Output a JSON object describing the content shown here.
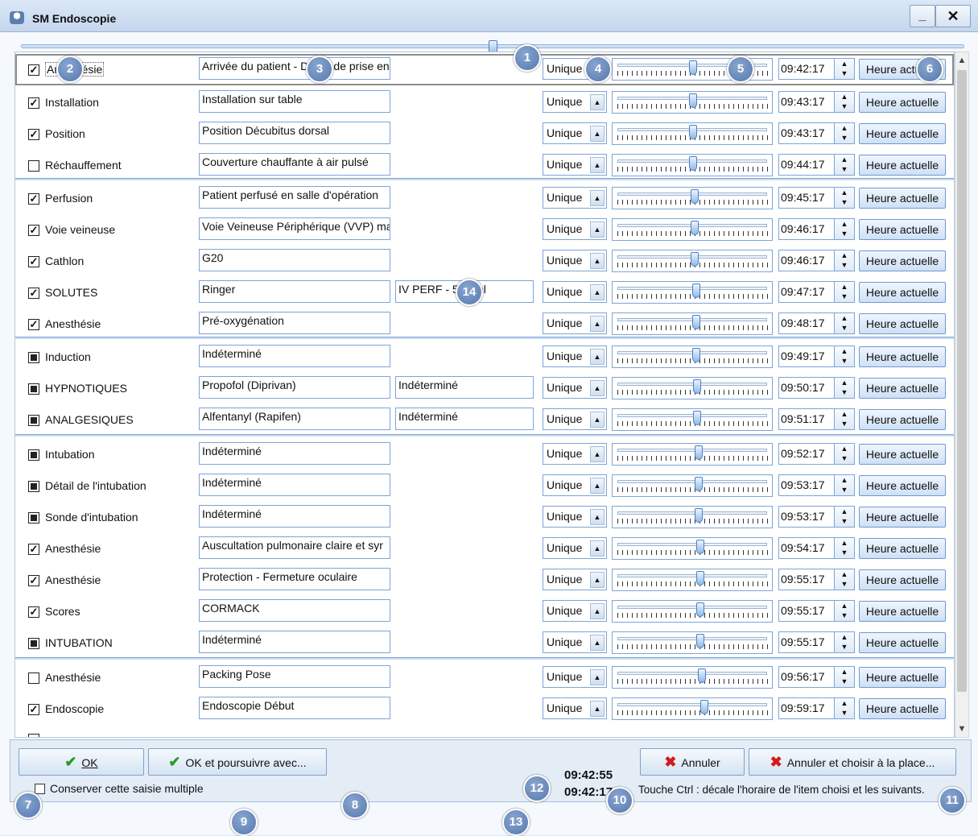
{
  "window": {
    "title": "SM Endoscopie",
    "min_label": "_",
    "close_label": "✕"
  },
  "rows": [
    {
      "checked": "checked",
      "label": "Anesthésie",
      "f1": "Arrivée du patient - Début de prise en charge",
      "f2": "",
      "mode": "Unique",
      "slider_pos": 0.5,
      "time": "09:42:17",
      "now": "Heure actuelle",
      "highlight": true
    },
    {
      "checked": "checked",
      "label": "Installation",
      "f1": "Installation sur table",
      "f2": "",
      "mode": "Unique",
      "slider_pos": 0.5,
      "time": "09:43:17",
      "now": "Heure actuelle"
    },
    {
      "checked": "checked",
      "label": "Position",
      "f1": "Position Décubitus dorsal",
      "f2": "",
      "mode": "Unique",
      "slider_pos": 0.5,
      "time": "09:43:17",
      "now": "Heure actuelle"
    },
    {
      "checked": "unchecked",
      "label": "Réchauffement",
      "f1": "Couverture chauffante à air pulsé",
      "f2": "",
      "mode": "Unique",
      "slider_pos": 0.5,
      "time": "09:44:17",
      "now": "Heure actuelle"
    },
    {
      "checked": "checked",
      "label": "Perfusion",
      "f1": "Patient perfusé en salle d'opération",
      "f2": "",
      "mode": "Unique",
      "slider_pos": 0.51,
      "time": "09:45:17",
      "now": "Heure actuelle"
    },
    {
      "checked": "checked",
      "label": "Voie veineuse",
      "f1": "Voie Veineuse Périphérique (VVP) ma",
      "f2": "",
      "mode": "Unique",
      "slider_pos": 0.51,
      "time": "09:46:17",
      "now": "Heure actuelle"
    },
    {
      "checked": "checked",
      "label": "Cathlon",
      "f1": "G20",
      "f2": "",
      "mode": "Unique",
      "slider_pos": 0.51,
      "time": "09:46:17",
      "now": "Heure actuelle"
    },
    {
      "checked": "checked",
      "label": "SOLUTES",
      "f1": "Ringer",
      "f2": "IV PERF - 500 ml",
      "mode": "Unique",
      "slider_pos": 0.52,
      "time": "09:47:17",
      "now": "Heure actuelle"
    },
    {
      "checked": "checked",
      "label": "Anesthésie",
      "f1": "Pré-oxygénation",
      "f2": "",
      "mode": "Unique",
      "slider_pos": 0.52,
      "time": "09:48:17",
      "now": "Heure actuelle"
    },
    {
      "checked": "ind",
      "label": "Induction",
      "f1": "Indéterminé",
      "f2": "",
      "mode": "Unique",
      "slider_pos": 0.52,
      "time": "09:49:17",
      "now": "Heure actuelle"
    },
    {
      "checked": "ind",
      "label": "HYPNOTIQUES",
      "f1": "Propofol (Diprivan)",
      "f2": "Indéterminé",
      "mode": "Unique",
      "slider_pos": 0.53,
      "time": "09:50:17",
      "now": "Heure actuelle"
    },
    {
      "checked": "ind",
      "label": "ANALGESIQUES",
      "f1": "Alfentanyl (Rapifen)",
      "f2": "Indéterminé",
      "mode": "Unique",
      "slider_pos": 0.53,
      "time": "09:51:17",
      "now": "Heure actuelle"
    },
    {
      "checked": "ind",
      "label": "Intubation",
      "f1": "Indéterminé",
      "f2": "",
      "mode": "Unique",
      "slider_pos": 0.54,
      "time": "09:52:17",
      "now": "Heure actuelle"
    },
    {
      "checked": "ind",
      "label": "Détail de l'intubation",
      "f1": "Indéterminé",
      "f2": "",
      "mode": "Unique",
      "slider_pos": 0.54,
      "time": "09:53:17",
      "now": "Heure actuelle"
    },
    {
      "checked": "ind",
      "label": "Sonde d'intubation",
      "f1": "Indéterminé",
      "f2": "",
      "mode": "Unique",
      "slider_pos": 0.54,
      "time": "09:53:17",
      "now": "Heure actuelle"
    },
    {
      "checked": "checked",
      "label": "Anesthésie",
      "f1": "Auscultation pulmonaire claire et syr",
      "f2": "",
      "mode": "Unique",
      "slider_pos": 0.55,
      "time": "09:54:17",
      "now": "Heure actuelle"
    },
    {
      "checked": "checked",
      "label": "Anesthésie",
      "f1": "Protection - Fermeture oculaire",
      "f2": "",
      "mode": "Unique",
      "slider_pos": 0.55,
      "time": "09:55:17",
      "now": "Heure actuelle"
    },
    {
      "checked": "checked",
      "label": "Scores",
      "f1": "CORMACK",
      "f2": "",
      "mode": "Unique",
      "slider_pos": 0.55,
      "time": "09:55:17",
      "now": "Heure actuelle"
    },
    {
      "checked": "ind",
      "label": "INTUBATION",
      "f1": "Indéterminé",
      "f2": "",
      "mode": "Unique",
      "slider_pos": 0.55,
      "time": "09:55:17",
      "now": "Heure actuelle"
    },
    {
      "checked": "unchecked",
      "label": "Anesthésie",
      "f1": "Packing Pose",
      "f2": "",
      "mode": "Unique",
      "slider_pos": 0.56,
      "time": "09:56:17",
      "now": "Heure actuelle"
    },
    {
      "checked": "checked",
      "label": "Endoscopie",
      "f1": "Endoscopie Début",
      "f2": "",
      "mode": "Unique",
      "slider_pos": 0.58,
      "time": "09:59:17",
      "now": "Heure actuelle"
    }
  ],
  "footer": {
    "ok": "OK",
    "ok_continue": "OK et poursuivre avec...",
    "cancel": "Annuler",
    "cancel_choose": "Annuler et choisir à la place...",
    "keep_label": "Conserver cette saisie multiple",
    "clock_now": "09:42:55",
    "clock_selected": "09:42:17",
    "hint": "Touche Ctrl : décale l'horaire de l'item choisi et les suivants."
  },
  "callouts": [
    "1",
    "2",
    "3",
    "4",
    "5",
    "6",
    "7",
    "8",
    "9",
    "10",
    "11",
    "12",
    "13",
    "14"
  ]
}
